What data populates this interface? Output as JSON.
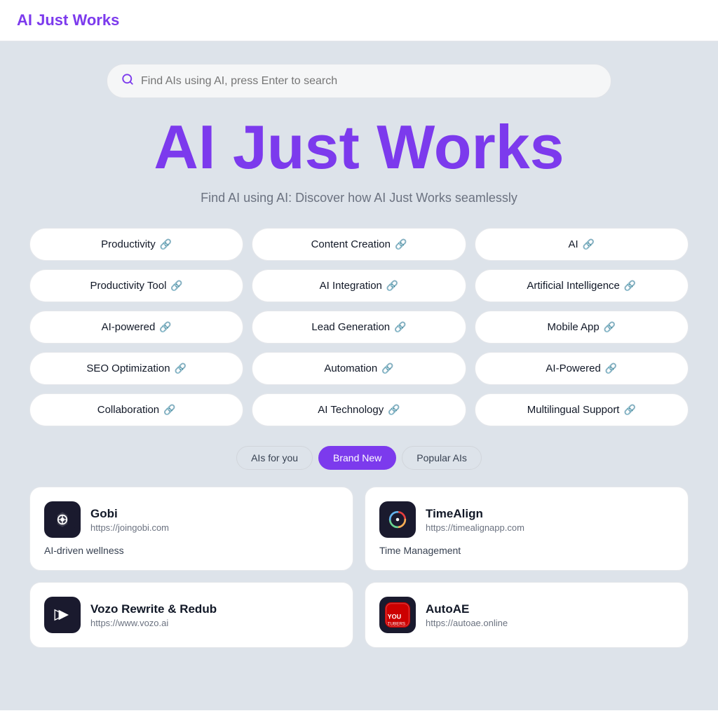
{
  "header": {
    "title": "AI Just Works"
  },
  "search": {
    "placeholder": "Find AIs using AI, press Enter to search"
  },
  "hero": {
    "title": "AI Just Works",
    "subtitle": "Find AI using AI: Discover how AI Just Works seamlessly"
  },
  "tags": [
    {
      "label": "Productivity",
      "col": 1
    },
    {
      "label": "Content Creation",
      "col": 2
    },
    {
      "label": "AI",
      "col": 3
    },
    {
      "label": "Productivity Tool",
      "col": 1
    },
    {
      "label": "AI Integration",
      "col": 2
    },
    {
      "label": "Artificial Intelligence",
      "col": 3
    },
    {
      "label": "AI-powered",
      "col": 1
    },
    {
      "label": "Lead Generation",
      "col": 2
    },
    {
      "label": "Mobile App",
      "col": 3
    },
    {
      "label": "SEO Optimization",
      "col": 1
    },
    {
      "label": "Automation",
      "col": 2
    },
    {
      "label": "AI-Powered",
      "col": 3
    },
    {
      "label": "Collaboration",
      "col": 1
    },
    {
      "label": "AI Technology",
      "col": 2
    },
    {
      "label": "Multilingual Support",
      "col": 3
    }
  ],
  "tabs": [
    {
      "label": "AIs for you",
      "active": false
    },
    {
      "label": "Brand New",
      "active": true
    },
    {
      "label": "Popular AIs",
      "active": false
    }
  ],
  "cards": [
    {
      "name": "Gobi",
      "url": "https://joingobi.com",
      "description": "AI-driven wellness",
      "logo_type": "gobi"
    },
    {
      "name": "TimeAlign",
      "url": "https://timealignapp.com",
      "description": "Time Management",
      "logo_type": "timealign"
    },
    {
      "name": "Vozo Rewrite & Redub",
      "url": "https://www.vozo.ai",
      "description": "",
      "logo_type": "vozo"
    },
    {
      "name": "AutoAE",
      "url": "https://autoae.online",
      "description": "",
      "logo_type": "autoae"
    }
  ]
}
